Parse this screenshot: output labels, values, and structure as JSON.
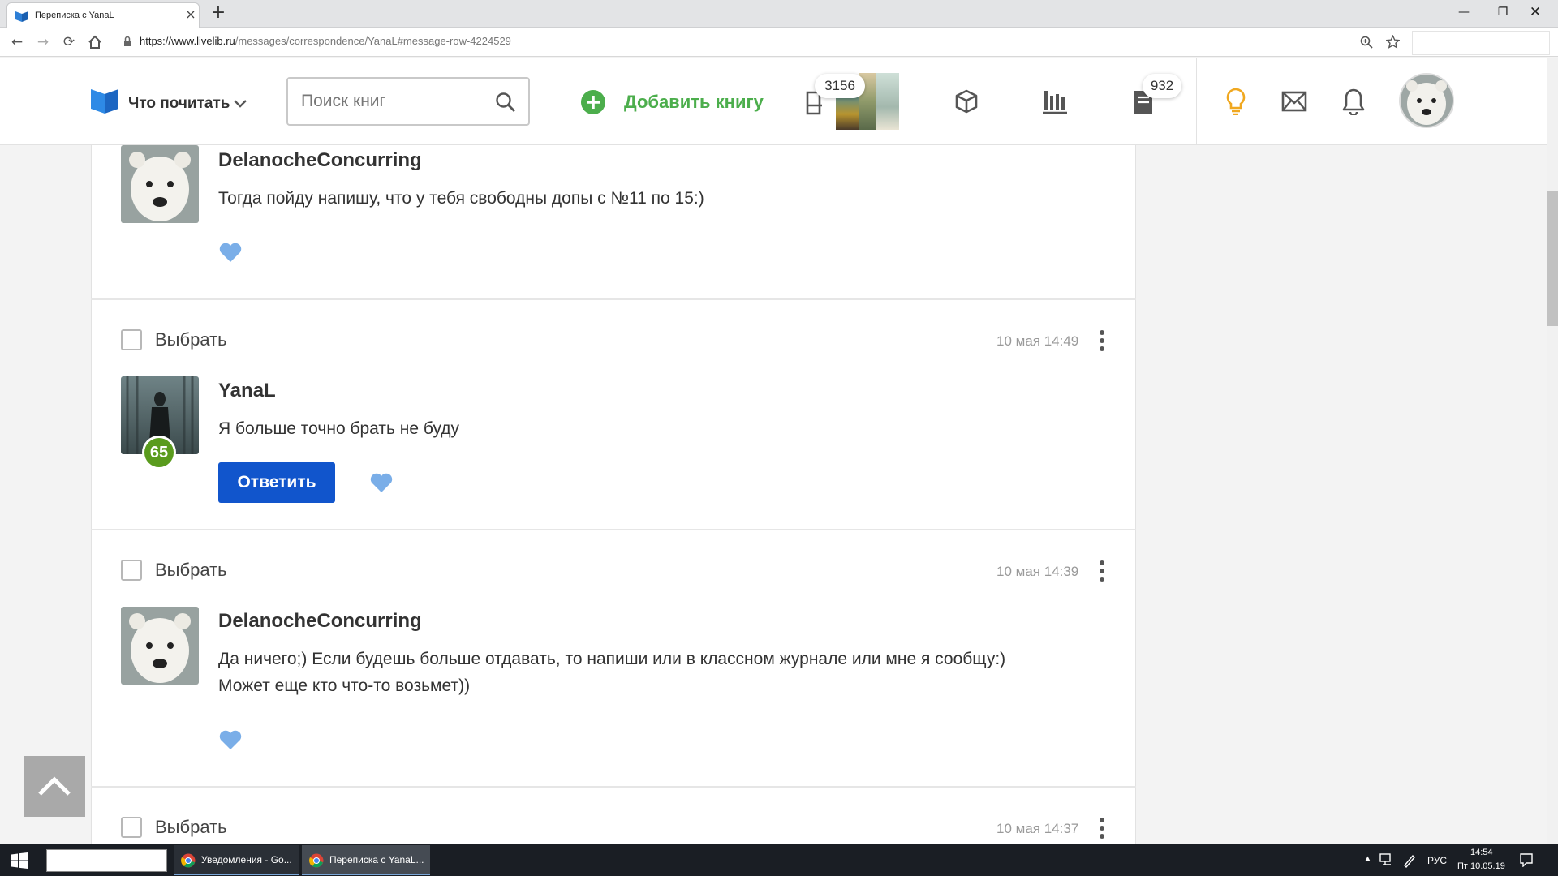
{
  "browser": {
    "tab_title": "Переписка с YanaL",
    "new_tab_symbol": "+",
    "close_symbol": "×",
    "url_host": "https://www.livelib.ru",
    "url_path": "/messages/correspondence/YanaL#message-row-4224529"
  },
  "header": {
    "nav_label": "Что почитать",
    "search_placeholder": "Поиск книг",
    "add_book_label": "Добавить книгу",
    "books_count": "3156",
    "reviews_count": "932"
  },
  "messages": [
    {
      "author": "DelanocheConcurring",
      "text": "Тогда пойду напишу, что у тебя свободны допы с №11 по 15:)"
    },
    {
      "select_label": "Выбрать",
      "date": "10 мая 14:49",
      "author": "YanaL",
      "level": "65",
      "text": "Я больше точно брать не буду",
      "reply_label": "Ответить"
    },
    {
      "select_label": "Выбрать",
      "date": "10 мая 14:39",
      "author": "DelanocheConcurring",
      "text_line1": "Да ничего;) Если будешь больше отдавать, то напиши или в классном журнале или мне я сообщу:)",
      "text_line2": "Может еще кто что-то возьмет))"
    },
    {
      "select_label": "Выбрать",
      "date": "10 мая 14:37"
    }
  ],
  "taskbar": {
    "app1": "Уведомления - Go...",
    "app2": "Переписка с YanaL...",
    "lang": "РУС",
    "time": "14:54",
    "date": "Пт 10.05.19"
  },
  "colors": {
    "accent_green": "#4cae4c",
    "reply_blue": "#1155cc",
    "like_blue": "#7aaee8",
    "level_green": "#5a9b1e"
  }
}
